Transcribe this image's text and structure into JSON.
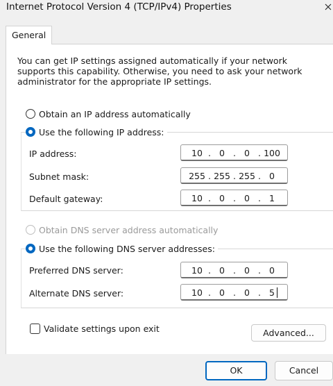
{
  "window": {
    "title": "Internet Protocol Version 4 (TCP/IPv4) Properties"
  },
  "tabs": [
    {
      "label": "General"
    }
  ],
  "description": "You can get IP settings assigned automatically if your network supports this capability. Otherwise, you need to ask your network administrator for the appropriate IP settings.",
  "ip": {
    "auto_label": "Obtain an IP address automatically",
    "manual_label": "Use the following IP address:",
    "mode": "manual",
    "fields": [
      {
        "label": "IP address:",
        "octets": [
          "10",
          "0",
          "0",
          "100"
        ]
      },
      {
        "label": "Subnet mask:",
        "octets": [
          "255",
          "255",
          "255",
          "0"
        ]
      },
      {
        "label": "Default gateway:",
        "octets": [
          "10",
          "0",
          "0",
          "1"
        ]
      }
    ]
  },
  "dns": {
    "auto_label": "Obtain DNS server address automatically",
    "manual_label": "Use the following DNS server addresses:",
    "mode": "manual",
    "fields": [
      {
        "label": "Preferred DNS server:",
        "octets": [
          "10",
          "0",
          "0",
          "0"
        ]
      },
      {
        "label": "Alternate DNS server:",
        "octets": [
          "10",
          "0",
          "0",
          "5"
        ]
      }
    ]
  },
  "validate": {
    "label": "Validate settings upon exit",
    "checked": false
  },
  "buttons": {
    "advanced": "Advanced...",
    "ok": "OK",
    "cancel": "Cancel"
  },
  "colors": {
    "accent": "#0067c0",
    "window_bg": "#f0f0f0",
    "panel_bg": "#ffffff"
  }
}
